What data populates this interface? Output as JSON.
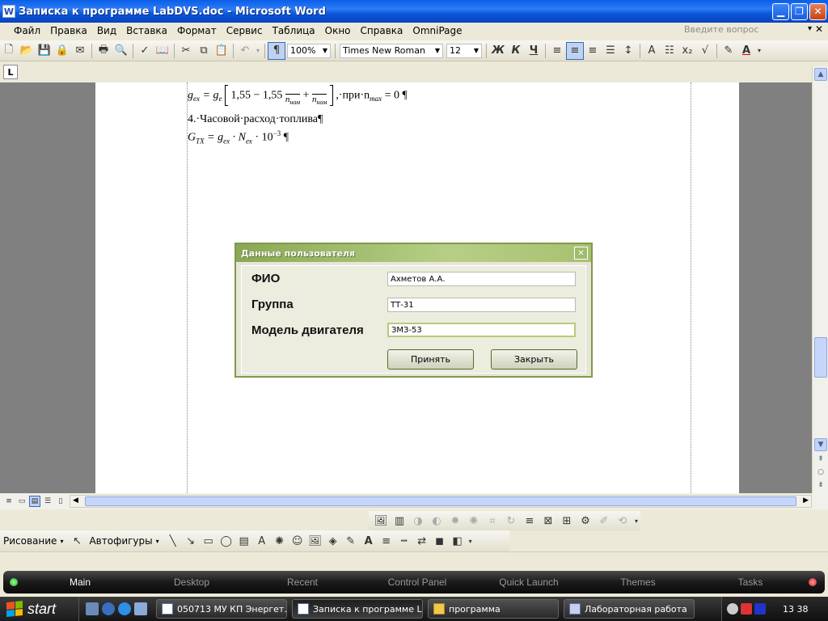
{
  "window": {
    "title": "Записка к программе LabDVS.doc - Microsoft Word",
    "app_icon_letter": "W"
  },
  "menu": {
    "items": [
      "Файл",
      "Правка",
      "Вид",
      "Вставка",
      "Формат",
      "Сервис",
      "Таблица",
      "Окно",
      "Справка",
      "OmniPage"
    ],
    "ask_placeholder": "Введите вопрос"
  },
  "toolbar": {
    "zoom": "100%",
    "font_name": "Times New Roman",
    "font_size": "12",
    "bold": "Ж",
    "italic": "К",
    "underline": "Ч"
  },
  "document": {
    "line1": "g",
    "line1_sub": "ex",
    "line1_eq": "= g",
    "line1_sub2": "e",
    "line1_mid": "1,55 − 1,55",
    "line1_frac_den": "n",
    "line1_frac_den_sub": "ном",
    "line1_frac_den2": "n",
    "line1_frac_den2_sub": "ном",
    "line1_tail": ",·при·n",
    "line1_tail_sub": "max",
    "line1_end": "= 0 ¶",
    "line2": "4.·Часовой·расход·топлива¶",
    "line3_g": "G",
    "line3_g_sub": "TX",
    "line3_eq": "= g",
    "line3_g2_sub": "ex",
    "line3_dot": "· N",
    "line3_n_sub": "ex",
    "line3_pow": "· 10",
    "line3_exp": "−3",
    "line3_end": "¶"
  },
  "dialog": {
    "title": "Данные пользователя",
    "fields": [
      {
        "label": "ФИО",
        "value": "Ахметов А.А."
      },
      {
        "label": "Группа",
        "value": "ТТ-31"
      },
      {
        "label": "Модель двигателя",
        "value": "ЗМЗ-53"
      }
    ],
    "accept_label": "Принять",
    "close_label": "Закрыть"
  },
  "drawing": {
    "draw_label": "Рисование",
    "autoshapes_label": "Автофигуры"
  },
  "launchbar": {
    "tabs": [
      "Main",
      "Desktop",
      "Recent",
      "Control Panel",
      "Quick Launch",
      "Themes",
      "Tasks"
    ]
  },
  "taskbar": {
    "start_label": "start",
    "items": [
      "050713 МУ КП Энергет...",
      "Записка к программе La...",
      "программа",
      "Лабораторная работа"
    ],
    "clock": "13 38"
  }
}
